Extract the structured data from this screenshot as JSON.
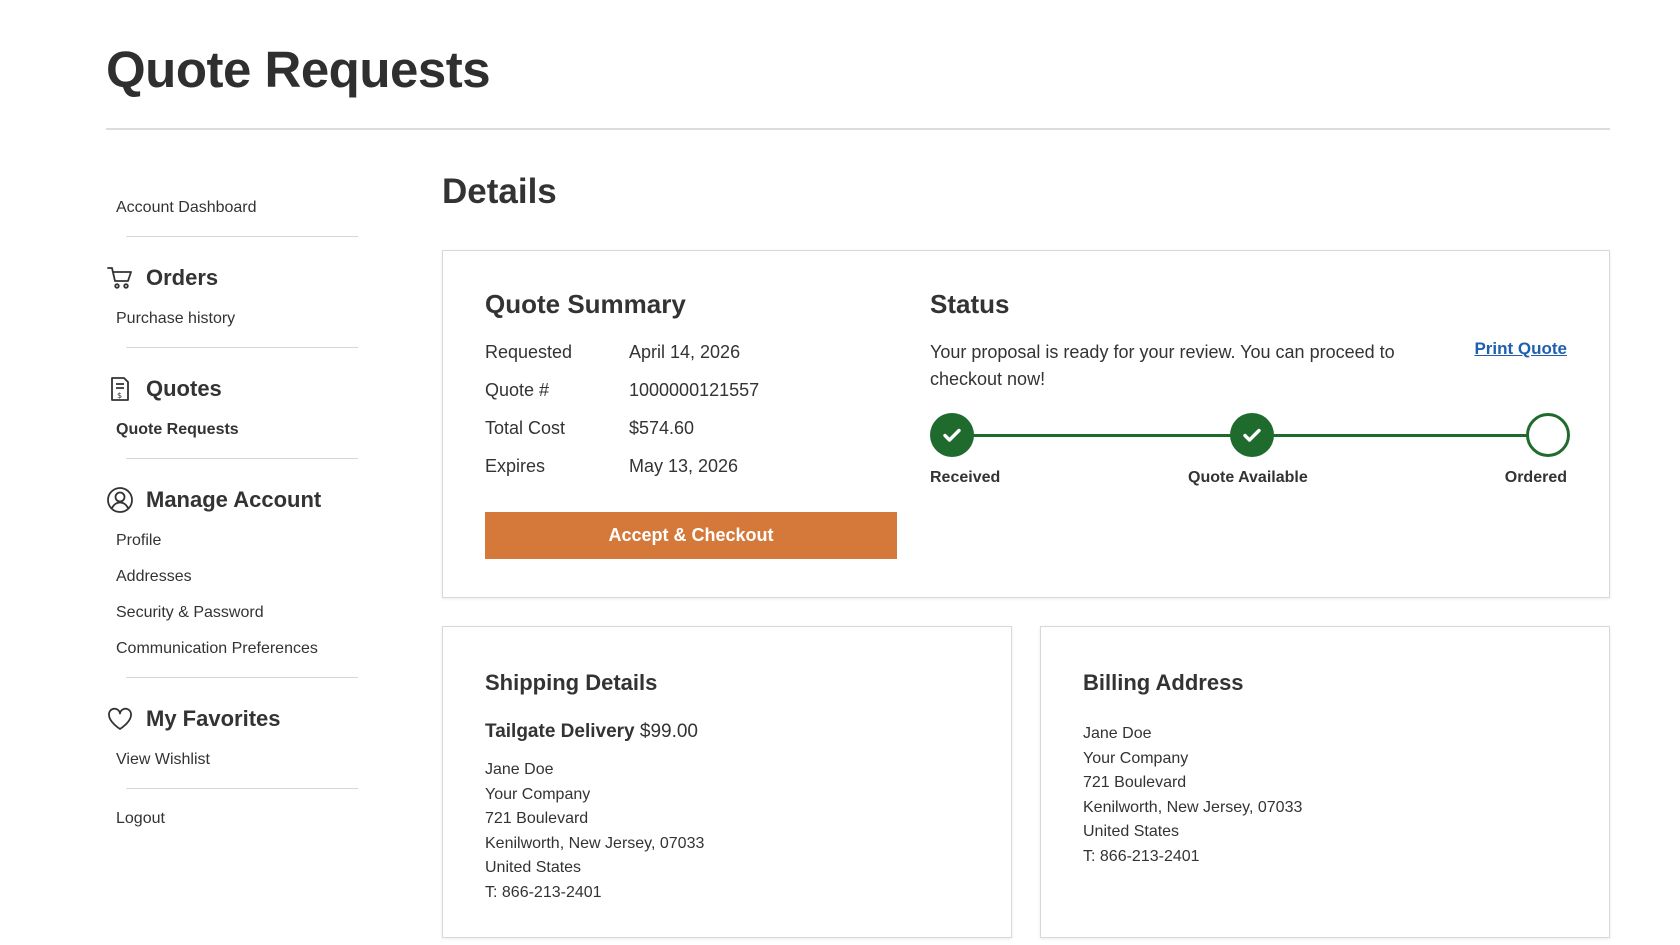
{
  "page": {
    "title": "Quote Requests"
  },
  "sidebar": {
    "account_dashboard": "Account Dashboard",
    "orders": {
      "heading": "Orders",
      "icon": "cart-icon",
      "items": [
        "Purchase history"
      ]
    },
    "quotes": {
      "heading": "Quotes",
      "icon": "quote-document-icon",
      "items": [
        "Quote Requests"
      ]
    },
    "manage_account": {
      "heading": "Manage Account",
      "icon": "user-circle-icon",
      "items": [
        "Profile",
        "Addresses",
        "Security & Password",
        "Communication Preferences"
      ]
    },
    "favorites": {
      "heading": "My Favorites",
      "icon": "heart-icon",
      "items": [
        "View Wishlist"
      ]
    },
    "logout": "Logout"
  },
  "main": {
    "title": "Details",
    "summary": {
      "heading": "Quote Summary",
      "rows": [
        {
          "label": "Requested",
          "value": "April 14, 2026"
        },
        {
          "label": "Quote #",
          "value": "1000000121557"
        },
        {
          "label": "Total Cost",
          "value": "$574.60"
        },
        {
          "label": "Expires",
          "value": "May 13, 2026"
        }
      ],
      "accept_label": "Accept & Checkout",
      "accent_color": "#d5793b"
    },
    "status": {
      "heading": "Status",
      "message": "Your proposal is ready for your review. You can proceed to checkout now!",
      "print_label": "Print Quote",
      "steps": [
        {
          "label": "Received",
          "done": true
        },
        {
          "label": "Quote Available",
          "done": true
        },
        {
          "label": "Ordered",
          "done": false
        }
      ],
      "progress_color": "#1f6b2e"
    },
    "shipping": {
      "heading": "Shipping Details",
      "method": "Tailgate Delivery",
      "price": "$99.00",
      "address": [
        "Jane Doe",
        "Your Company",
        "721 Boulevard",
        "Kenilworth, New Jersey, 07033",
        "United States",
        "T: 866-213-2401"
      ]
    },
    "billing": {
      "heading": "Billing Address",
      "address": [
        "Jane Doe",
        "Your Company",
        "721 Boulevard",
        "Kenilworth, New Jersey, 07033",
        "United States",
        "T: 866-213-2401"
      ]
    }
  }
}
